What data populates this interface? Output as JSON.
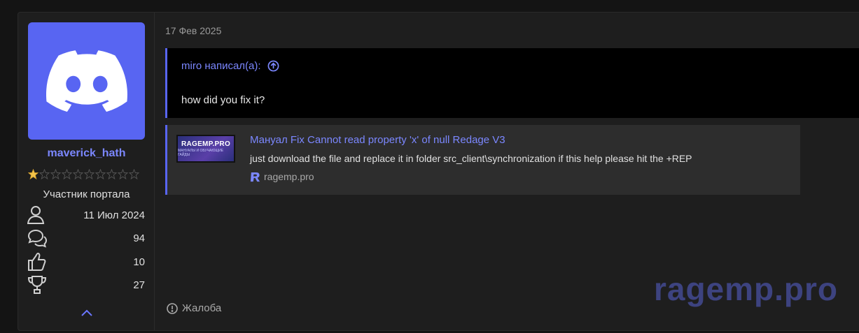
{
  "user": {
    "username": "maverick_hath",
    "role": "Участник портала",
    "rating": {
      "filled": 1,
      "total": 10
    },
    "stats": [
      {
        "icon": "user-icon",
        "value": "11 Июл 2024"
      },
      {
        "icon": "messages-icon",
        "value": "94"
      },
      {
        "icon": "thumbs-up-icon",
        "value": "10"
      },
      {
        "icon": "trophy-icon",
        "value": "27"
      }
    ]
  },
  "post": {
    "date": "17 Фев 2025",
    "quote": {
      "author_label": "miro написал(а):",
      "text": "how did you fix it?"
    },
    "unfurl": {
      "thumb_title": "RAGEMP.PRO",
      "thumb_subtitle": "МАНУАЛЫ И ОБУЧАЮЩИЕ ГАЙДЫ",
      "title": "Мануал Fix Cannot read property 'x' of null Redage V3",
      "description": "just download the file and replace it in folder src_client\\synchronization if this help please hit the +REP",
      "domain": "ragemp.pro"
    },
    "report_label": "Жалоба"
  },
  "watermark": "ragemp.pro",
  "colors": {
    "accent": "#5865f2",
    "link": "#7b87ff",
    "background": "#1e1e1e"
  }
}
